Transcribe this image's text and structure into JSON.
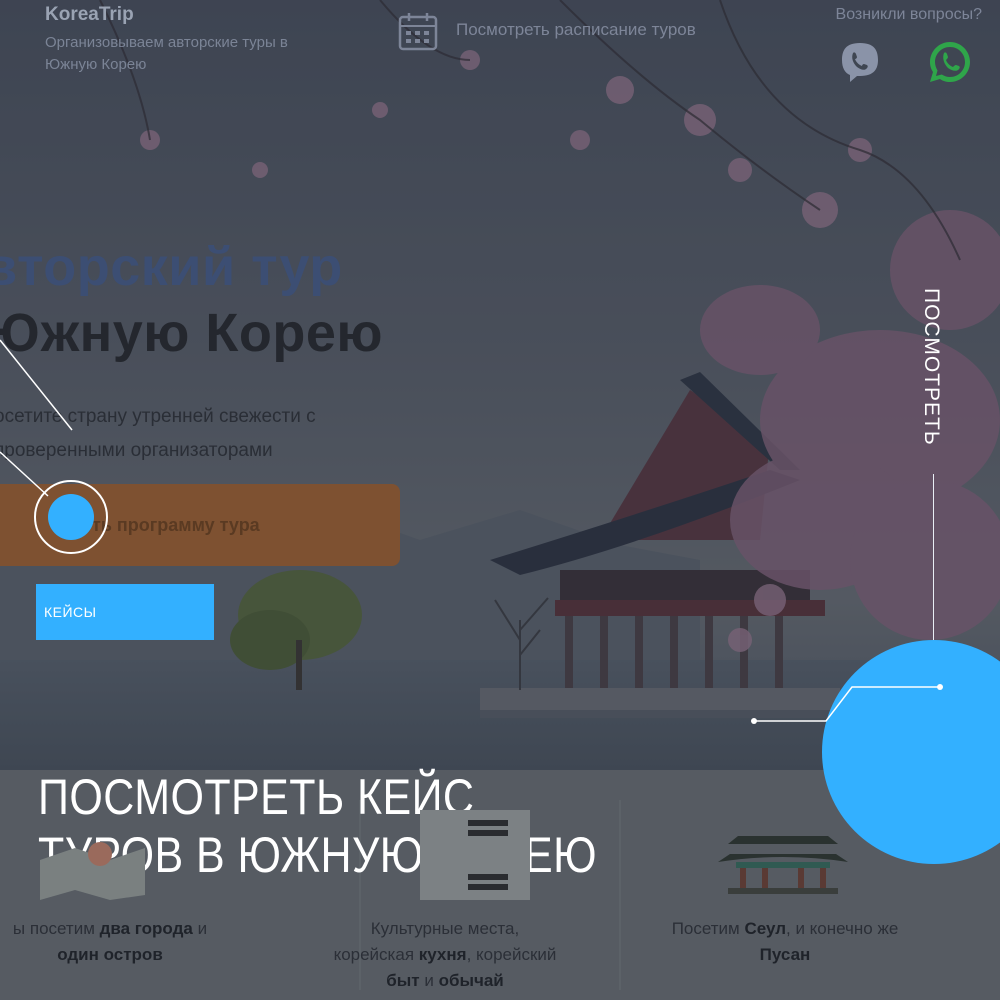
{
  "site": {
    "brand_title": "KoreaTrip",
    "brand_subtitle": "Организовываем авторские туры в Южную Корею",
    "schedule_link": "Посмотреть расписание туров",
    "question_text": "Возникли вопросы?"
  },
  "hero": {
    "title_line1": "вторский тур",
    "title_line2": "Южную Корею",
    "subtitle": "осетите страну утренней свежести с проверенными организаторами",
    "button_label": "ть программу тура"
  },
  "overlay": {
    "cases_button": "КЕЙСЫ",
    "side_link": "ПОСМОТРЕТЬ",
    "headline_line1": "ПОСМОТРЕТЬ КЕЙС",
    "headline_line2": "ТУРОВ В ЮЖНУЮ КОРЕЮ"
  },
  "features": [
    {
      "pre": "ы посетим ",
      "b1": "два города",
      "mid": " и",
      "b2": "один остров",
      "post": ""
    },
    {
      "pre": "Культурные места,",
      "mid1": "корейская ",
      "b1": "кухня",
      "mid2": ", корейский",
      "b2": "быт",
      "mid3": " и ",
      "b3": "обычай"
    },
    {
      "pre": "Посетим ",
      "b1": "Сеул",
      "mid": ", и конечно же",
      "b2": "Пусан"
    }
  ],
  "icons": [
    "calendar-icon",
    "viber-icon",
    "whatsapp-icon",
    "map-icon",
    "korea-flag-icon",
    "palace-icon"
  ],
  "colors": {
    "accent": "#33b0ff",
    "headline_text": "#ffffff",
    "hero_button": "#7e5131",
    "whatsapp": "#2fa54a"
  }
}
